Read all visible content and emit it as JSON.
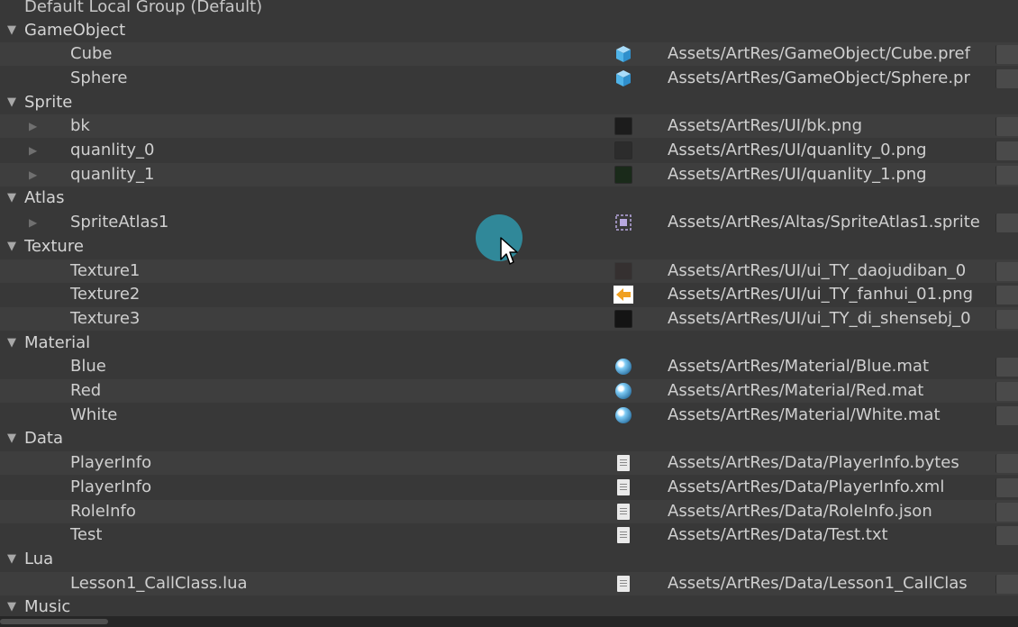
{
  "header": {
    "title": "Default Local Group (Default)"
  },
  "groups": [
    {
      "name": "GameObject",
      "items": [
        {
          "name": "Cube",
          "icon": "prefab-cube-icon",
          "path": "Assets/ArtRes/GameObject/Cube.pref",
          "subfold": false
        },
        {
          "name": "Sphere",
          "icon": "prefab-cube-icon",
          "path": "Assets/ArtRes/GameObject/Sphere.pr",
          "subfold": false
        }
      ]
    },
    {
      "name": "Sprite",
      "items": [
        {
          "name": "bk",
          "icon": "sprite-dark-icon",
          "path": "Assets/ArtRes/UI/bk.png",
          "subfold": true
        },
        {
          "name": "quanlity_0",
          "icon": "sprite-gray-icon",
          "path": "Assets/ArtRes/UI/quanlity_0.png",
          "subfold": true
        },
        {
          "name": "quanlity_1",
          "icon": "sprite-green-icon",
          "path": "Assets/ArtRes/UI/quanlity_1.png",
          "subfold": true
        }
      ]
    },
    {
      "name": "Atlas",
      "items": [
        {
          "name": "SpriteAtlas1",
          "icon": "sprite-atlas-icon",
          "path": "Assets/ArtRes/Altas/SpriteAtlas1.sprite",
          "subfold": true
        }
      ]
    },
    {
      "name": "Texture",
      "items": [
        {
          "name": "Texture1",
          "icon": "texture-dark-icon",
          "path": "Assets/ArtRes/UI/ui_TY_daojudiban_0",
          "subfold": false
        },
        {
          "name": "Texture2",
          "icon": "texture-orange-icon",
          "path": "Assets/ArtRes/UI/ui_TY_fanhui_01.png",
          "subfold": false
        },
        {
          "name": "Texture3",
          "icon": "texture-black-icon",
          "path": "Assets/ArtRes/UI/ui_TY_di_shensebj_0",
          "subfold": false
        }
      ]
    },
    {
      "name": "Material",
      "items": [
        {
          "name": "Blue",
          "icon": "material-sphere-icon",
          "path": "Assets/ArtRes/Material/Blue.mat",
          "subfold": false
        },
        {
          "name": "Red",
          "icon": "material-sphere-icon",
          "path": "Assets/ArtRes/Material/Red.mat",
          "subfold": false
        },
        {
          "name": "White",
          "icon": "material-sphere-icon",
          "path": "Assets/ArtRes/Material/White.mat",
          "subfold": false
        }
      ]
    },
    {
      "name": "Data",
      "items": [
        {
          "name": "PlayerInfo",
          "icon": "text-file-icon",
          "path": "Assets/ArtRes/Data/PlayerInfo.bytes",
          "subfold": false
        },
        {
          "name": "PlayerInfo",
          "icon": "text-file-icon",
          "path": "Assets/ArtRes/Data/PlayerInfo.xml",
          "subfold": false
        },
        {
          "name": "RoleInfo",
          "icon": "text-file-icon",
          "path": "Assets/ArtRes/Data/RoleInfo.json",
          "subfold": false
        },
        {
          "name": "Test",
          "icon": "text-file-icon",
          "path": "Assets/ArtRes/Data/Test.txt",
          "subfold": false
        }
      ]
    },
    {
      "name": "Lua",
      "items": [
        {
          "name": "Lesson1_CallClass.lua",
          "icon": "text-file-icon",
          "path": "Assets/ArtRes/Data/Lesson1_CallClas",
          "subfold": false
        }
      ]
    },
    {
      "name": "Music",
      "items": []
    }
  ],
  "icons": {
    "fold_open": "▼",
    "fold_closed": "▶"
  },
  "colors": {
    "cursor_highlight": "#2f96aa",
    "cube_blue": "#4fb3e8",
    "texture_orange": "#f0a020"
  }
}
